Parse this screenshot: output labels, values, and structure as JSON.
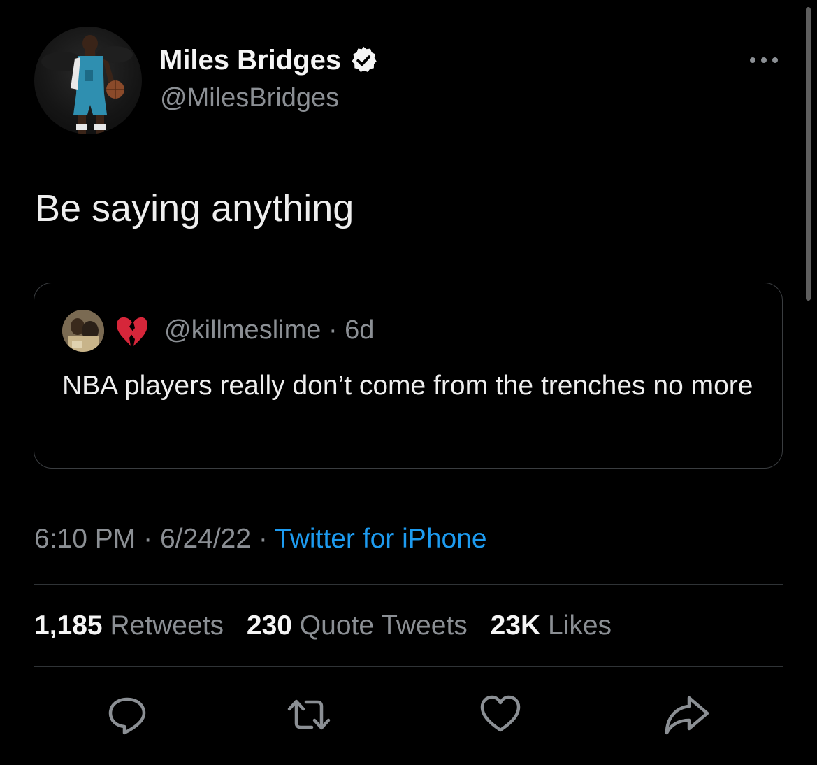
{
  "tweet": {
    "author_name": "Miles Bridges",
    "author_handle": "@MilesBridges",
    "text": "Be saying anything",
    "time": "6:10 PM",
    "separator": "·",
    "date": "6/24/22",
    "source": "Twitter for iPhone"
  },
  "quoted_tweet": {
    "handle": "@killmeslime",
    "age": "6d",
    "text": "NBA players really don’t come from the trenches no more"
  },
  "stats": {
    "retweets_count": "1,185",
    "retweets_label": "Retweets",
    "quotes_count": "230",
    "quotes_label": "Quote Tweets",
    "likes_count": "23K",
    "likes_label": "Likes"
  },
  "icons": {
    "verified": "verified-badge-icon",
    "more": "more-dots-icon",
    "reply": "reply-icon",
    "retweet": "retweet-icon",
    "like": "heart-icon",
    "share": "share-icon",
    "quote_emoji": "broken-heart-emoji"
  },
  "colors": {
    "background": "#000000",
    "primary_text": "#eeeeee",
    "secondary_text": "#8b8f94",
    "link": "#1d9bf0",
    "divider": "#2f3336",
    "emoji_red": "#d6263a"
  }
}
